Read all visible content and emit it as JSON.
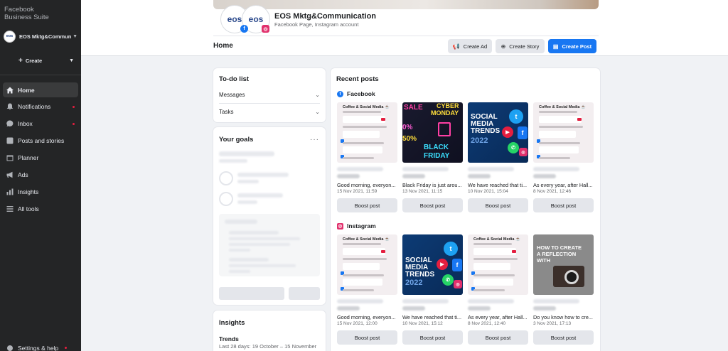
{
  "colors": {
    "accent": "#1877f2",
    "sidebar_bg": "#242526",
    "page_bg": "#f0f2f5",
    "notification_dot": "#e41e3f"
  },
  "sidebar": {
    "brand_line1": "Facebook",
    "brand_line2": "Business Suite",
    "account_name": "EOS Mktg&Communication",
    "account_avatar_text": "eos",
    "create_label": "Create",
    "items": [
      {
        "label": "Home",
        "icon": "home-icon",
        "active": true,
        "dot": false
      },
      {
        "label": "Notifications",
        "icon": "bell-icon",
        "active": false,
        "dot": true
      },
      {
        "label": "Inbox",
        "icon": "inbox-icon",
        "active": false,
        "dot": true
      },
      {
        "label": "Posts and stories",
        "icon": "posts-icon",
        "active": false,
        "dot": false
      },
      {
        "label": "Planner",
        "icon": "calendar-icon",
        "active": false,
        "dot": false
      },
      {
        "label": "Ads",
        "icon": "megaphone-icon",
        "active": false,
        "dot": false
      },
      {
        "label": "Insights",
        "icon": "chart-icon",
        "active": false,
        "dot": false
      },
      {
        "label": "All tools",
        "icon": "menu-icon",
        "active": false,
        "dot": false
      }
    ],
    "settings_label": "Settings & help"
  },
  "header": {
    "page_name": "EOS Mktg&Communication",
    "page_sub": "Facebook Page, Instagram account",
    "avatar_text": "eos",
    "home_title": "Home",
    "create_ad": "Create Ad",
    "create_story": "Create Story",
    "create_post": "Create Post"
  },
  "todo": {
    "title": "To-do list",
    "rows": [
      "Messages",
      "Tasks"
    ]
  },
  "goals": {
    "title": "Your goals",
    "more": "···"
  },
  "insights": {
    "title": "Insights",
    "trends": "Trends",
    "period": "Last 28 days: 19 October – 15 November"
  },
  "recent": {
    "title": "Recent posts",
    "facebook_label": "Facebook",
    "instagram_label": "Instagram",
    "boost_label": "Boost post",
    "facebook_posts": [
      {
        "thumb": "coffee",
        "caption": "Good morning, everyon...",
        "date": "15 Nov 2021, 11:59"
      },
      {
        "thumb": "friday",
        "caption": "Black Friday is just arou...",
        "date": "13 Nov 2021, 11:15"
      },
      {
        "thumb": "social",
        "caption": "We have reached that ti...",
        "date": "10 Nov 2021, 15:04"
      },
      {
        "thumb": "coffee",
        "caption": "As every year, after Hall...",
        "date": "8 Nov 2021, 12:46"
      }
    ],
    "instagram_posts": [
      {
        "thumb": "coffee",
        "caption": "Good morning, everyon...",
        "date": "15 Nov 2021, 12:00"
      },
      {
        "thumb": "social2",
        "caption": "We have reached that ti...",
        "date": "10 Nov 2021, 15:12"
      },
      {
        "thumb": "coffee",
        "caption": "As every year, after Hall...",
        "date": "8 Nov 2021, 12:40"
      },
      {
        "thumb": "reflect",
        "caption": "Do you know how to cre...",
        "date": "3 Nov 2021, 17:13"
      }
    ],
    "thumb_text": {
      "coffee_heading": "Coffee & Social Media ☕",
      "friday_words": [
        "SALE",
        "CYBER",
        "MONDAY",
        "0%",
        "50%",
        "BLACK",
        "FRIDAY"
      ],
      "social_words": [
        "SOCIAL",
        "MEDIA",
        "TRENDS",
        "2022"
      ],
      "reflect_words": [
        "HOW TO CREATE",
        "A REFLECTION",
        "WITH"
      ]
    }
  }
}
